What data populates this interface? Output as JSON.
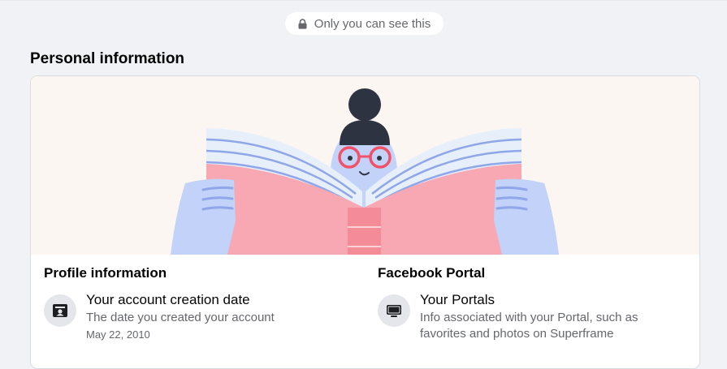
{
  "privacy": {
    "label": "Only you can see this",
    "icon": "lock-icon"
  },
  "section": {
    "title": "Personal information"
  },
  "banner": {
    "illustration": "person-reading-book-illustration",
    "colors": {
      "background": "#fbf6f2",
      "book_cover": "#f7a8b2",
      "spine": "#f48b98",
      "pages": "#e7effb",
      "page_lines": "#8fa6e8",
      "hands": "#c2d2f9",
      "hair": "#2e3341",
      "glasses": "#f25267"
    }
  },
  "columns": [
    {
      "title": "Profile information",
      "item": {
        "icon": "id-card-icon",
        "title": "Your account creation date",
        "description": "The date you created your account",
        "meta": "May 22, 2010"
      }
    },
    {
      "title": "Facebook Portal",
      "item": {
        "icon": "portal-device-icon",
        "title": "Your Portals",
        "description": "Info associated with your Portal, such as favorites and photos on Superframe"
      }
    }
  ]
}
